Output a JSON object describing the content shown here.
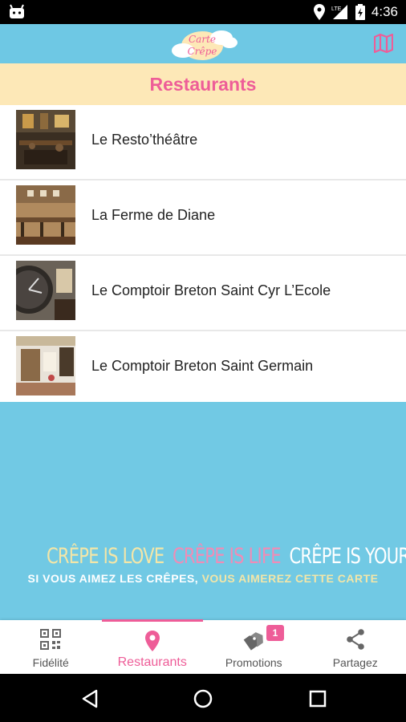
{
  "status_bar": {
    "network": "LTE",
    "time": "4:36"
  },
  "header": {
    "logo_text_top": "Carte",
    "logo_text_bottom": "Crêpe"
  },
  "page_title": "Restaurants",
  "restaurants": [
    {
      "name": "Le Resto’théâtre"
    },
    {
      "name": "La Ferme de Diane"
    },
    {
      "name": "Le Comptoir Breton Saint Cyr L’Ecole"
    },
    {
      "name": "Le Comptoir Breton Saint Germain"
    }
  ],
  "slogan": {
    "part1": "CRÊPE IS LOVE",
    "part2": "CRÊPE IS LIFE",
    "part3": "CRÊPE IS YOURS",
    "line2_a": "SI VOUS AIMEZ LES CRÊPES,",
    "line2_b": "VOUS AIMEREZ CETTE CARTE"
  },
  "bottom_nav": [
    {
      "label": "Fidélité",
      "icon": "qr-code-icon"
    },
    {
      "label": "Restaurants",
      "icon": "location-pin-icon"
    },
    {
      "label": "Promotions",
      "icon": "tags-icon",
      "badge": "1"
    },
    {
      "label": "Partagez",
      "icon": "share-icon"
    }
  ],
  "colors": {
    "sky": "#71c9e4",
    "accent": "#ee5d98",
    "title_bg": "#fde8b7"
  }
}
